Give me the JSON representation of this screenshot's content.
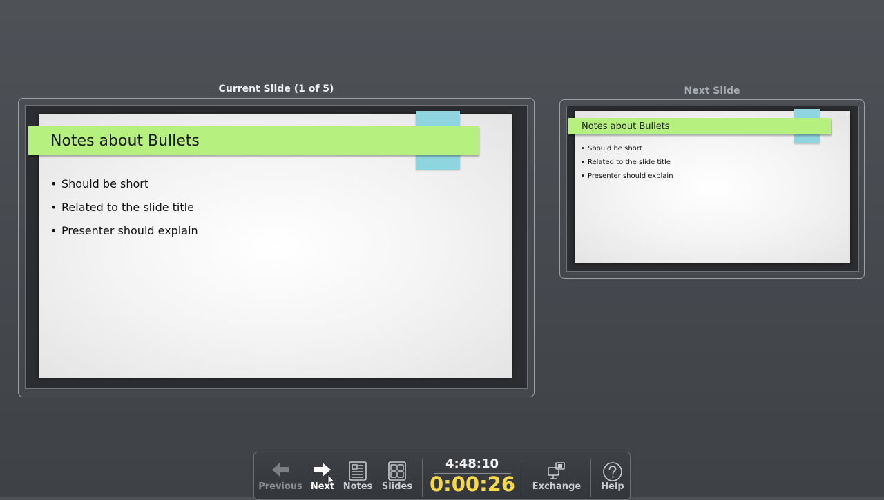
{
  "current_panel": {
    "label": "Current Slide (1 of 5)",
    "slide": {
      "title": "Notes about Bullets",
      "bullets": [
        "Should be short",
        "Related to the slide title",
        "Presenter should explain"
      ]
    }
  },
  "next_panel": {
    "label": "Next Slide",
    "slide": {
      "title": "Notes about Bullets",
      "bullets": [
        "Should be short",
        "Related to the slide title",
        "Presenter should explain"
      ]
    }
  },
  "toolbar": {
    "previous_label": "Previous",
    "next_label": "Next",
    "notes_label": "Notes",
    "slides_label": "Slides",
    "clock": "4:48:10",
    "elapsed": "0:00:26",
    "exchange_label": "Exchange",
    "help_label": "Help"
  },
  "colors": {
    "title_bar": "#b6f07f",
    "accent_tab": "#8fd5e0",
    "timer": "#f5d94a"
  },
  "bullet_glyph": "•"
}
